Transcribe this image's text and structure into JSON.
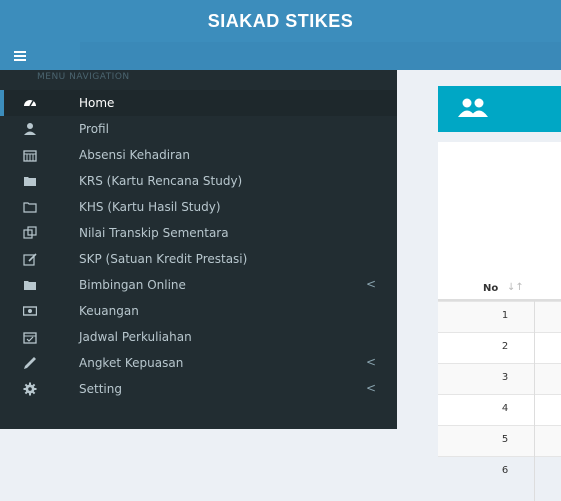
{
  "app": {
    "brand": "SIAKAD STIKES"
  },
  "sidebar": {
    "header": "MENU NAVIGATION",
    "items": [
      {
        "label": "Home",
        "icon": "dashboard-icon",
        "active": true,
        "chevron": ""
      },
      {
        "label": "Profil",
        "icon": "user-icon",
        "chevron": ""
      },
      {
        "label": "Absensi Kehadiran",
        "icon": "calendar-icon",
        "chevron": ""
      },
      {
        "label": "KRS (Kartu Rencana Study)",
        "icon": "folder-icon",
        "chevron": ""
      },
      {
        "label": "KHS (Kartu Hasil Study)",
        "icon": "file-icon",
        "chevron": ""
      },
      {
        "label": "Nilai Transkip Sementara",
        "icon": "clone-icon",
        "chevron": ""
      },
      {
        "label": "SKP (Satuan Kredit Prestasi)",
        "icon": "edit-icon",
        "chevron": ""
      },
      {
        "label": "Bimbingan Online",
        "icon": "folder-icon",
        "chevron": "<"
      },
      {
        "label": "Keuangan",
        "icon": "money-icon",
        "chevron": ""
      },
      {
        "label": "Jadwal Perkuliahan",
        "icon": "calendar-check-icon",
        "chevron": ""
      },
      {
        "label": "Angket Kepuasan",
        "icon": "pencil-icon",
        "chevron": "<"
      },
      {
        "label": "Setting",
        "icon": "gear-icon",
        "chevron": "<"
      }
    ]
  },
  "content": {
    "table": {
      "header_no": "No",
      "sort_glyph": "↓↑",
      "rows": [
        "1",
        "2",
        "3",
        "4",
        "5",
        "6"
      ]
    }
  },
  "colors": {
    "primary": "#3c8dbc",
    "sidebar": "#222d32",
    "info": "#00a7c5"
  }
}
